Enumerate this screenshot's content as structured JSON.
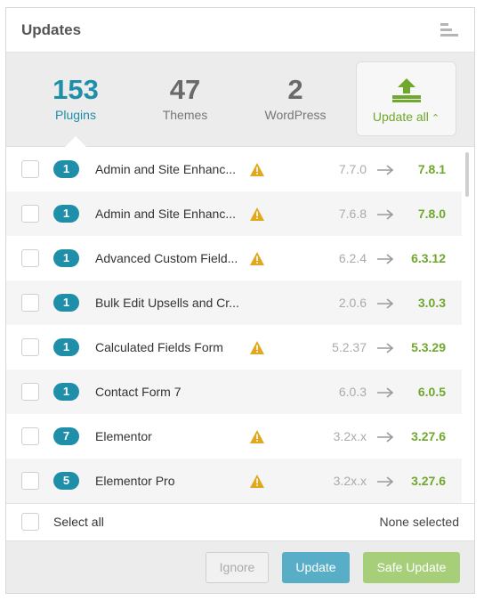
{
  "header": {
    "title": "Updates",
    "icon": "bars-icon"
  },
  "summary": {
    "plugins": {
      "count": "153",
      "label": "Plugins"
    },
    "themes": {
      "count": "47",
      "label": "Themes"
    },
    "wordpress": {
      "count": "2",
      "label": "WordPress"
    },
    "update_all": {
      "label": "Update all",
      "icon": "upload-icon"
    }
  },
  "colors": {
    "accent": "#1f8ea8",
    "green": "#6fa82c",
    "warning": "#e0a81c"
  },
  "plugins": [
    {
      "count": "1",
      "name": "Admin and Site Enhanc...",
      "warning": true,
      "from": "7.7.0",
      "to": "7.8.1"
    },
    {
      "count": "1",
      "name": "Admin and Site Enhanc...",
      "warning": true,
      "from": "7.6.8",
      "to": "7.8.0"
    },
    {
      "count": "1",
      "name": "Advanced Custom Field...",
      "warning": true,
      "from": "6.2.4",
      "to": "6.3.12"
    },
    {
      "count": "1",
      "name": "Bulk Edit Upsells and Cr...",
      "warning": false,
      "from": "2.0.6",
      "to": "3.0.3"
    },
    {
      "count": "1",
      "name": "Calculated Fields Form",
      "warning": true,
      "from": "5.2.37",
      "to": "5.3.29"
    },
    {
      "count": "1",
      "name": "Contact Form 7",
      "warning": false,
      "from": "6.0.3",
      "to": "6.0.5"
    },
    {
      "count": "7",
      "name": "Elementor",
      "warning": true,
      "from": "3.2x.x",
      "to": "3.27.6"
    },
    {
      "count": "5",
      "name": "Elementor Pro",
      "warning": true,
      "from": "3.2x.x",
      "to": "3.27.6"
    }
  ],
  "selection": {
    "select_all_label": "Select all",
    "status": "None selected"
  },
  "footer": {
    "ignore_label": "Ignore",
    "update_label": "Update",
    "safe_update_label": "Safe Update"
  }
}
